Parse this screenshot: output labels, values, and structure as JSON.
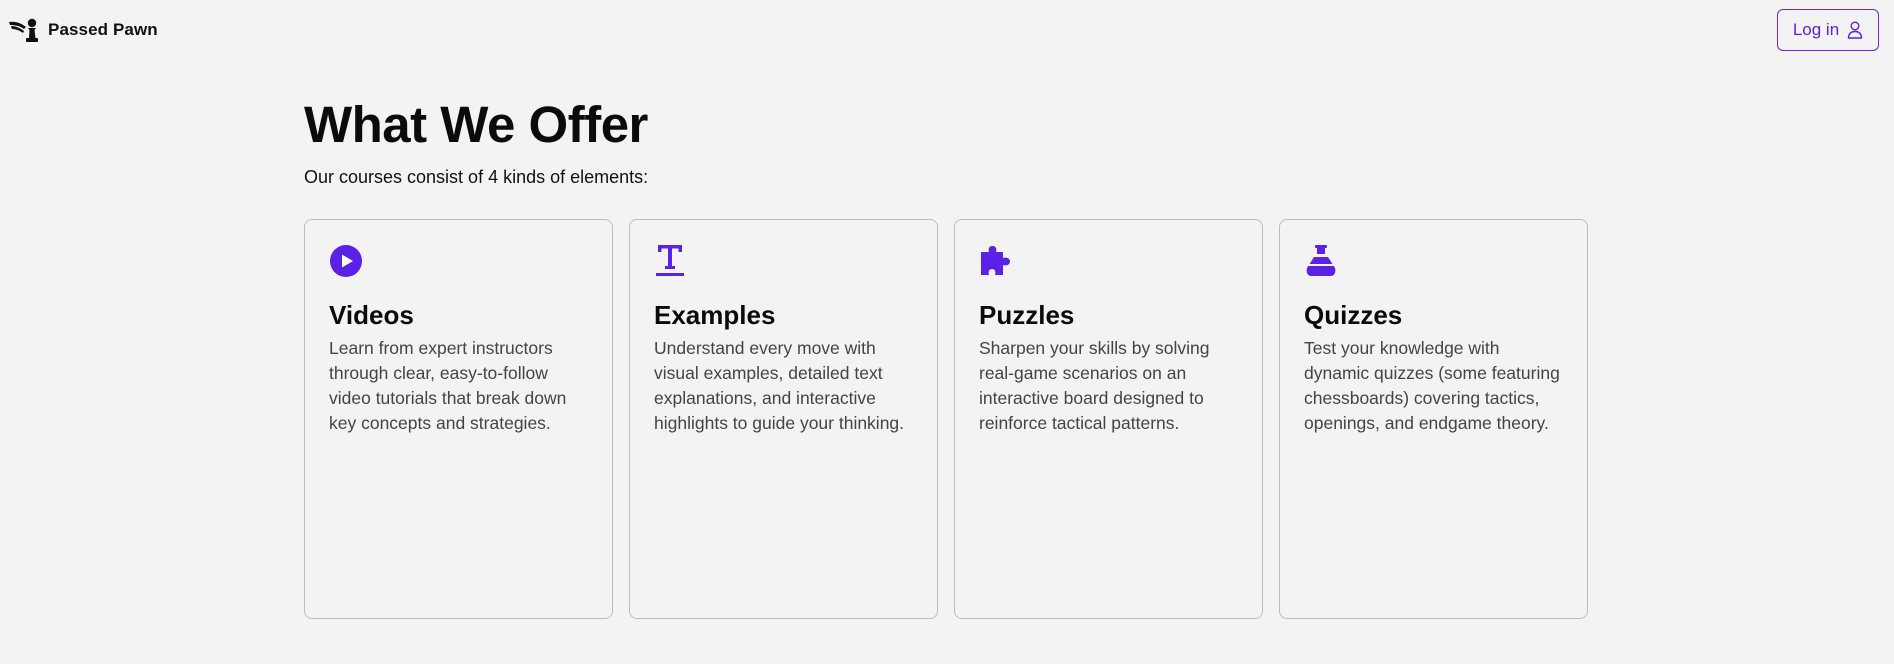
{
  "header": {
    "brand_name": "Passed Pawn",
    "logo_icon": "winged-pawn-icon",
    "login_label": "Log in",
    "login_icon": "user-icon"
  },
  "colors": {
    "accent": "#5b21e6",
    "background": "#f3f3f3",
    "card_border": "#bdbdbd"
  },
  "main": {
    "title": "What We Offer",
    "subtitle": "Our courses consist of 4 kinds of elements:",
    "cards": [
      {
        "icon": "play-icon",
        "title": "Videos",
        "description": "Learn from expert instructors through clear, easy-to-follow video tutorials that break down key concepts and strategies."
      },
      {
        "icon": "text-icon",
        "title": "Examples",
        "description": "Understand every move with visual examples, detailed text explanations, and interactive highlights to guide your thinking."
      },
      {
        "icon": "puzzle-icon",
        "title": "Puzzles",
        "description": "Sharpen your skills by solving real-game scenarios on an interactive board designed to reinforce tactical patterns."
      },
      {
        "icon": "flask-icon",
        "title": "Quizzes",
        "description": "Test your knowledge with dynamic quizzes (some featuring chessboards) covering tactics, openings, and endgame theory."
      }
    ]
  }
}
